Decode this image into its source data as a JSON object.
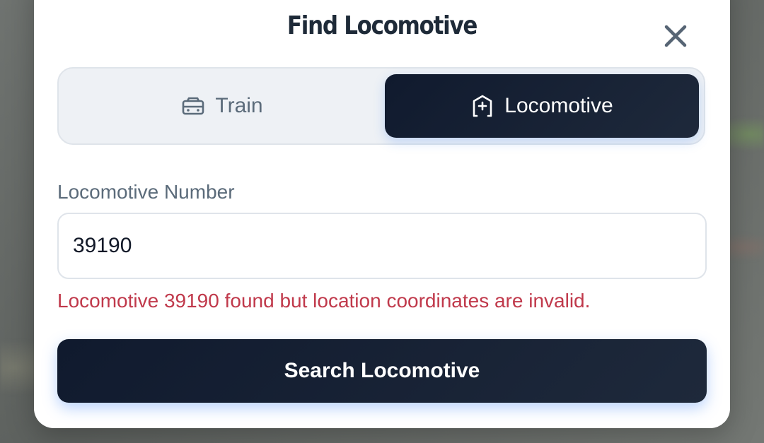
{
  "dialog": {
    "title": "Find Locomotive",
    "close_icon": "close-icon"
  },
  "mode_toggle": {
    "options": [
      {
        "label": "Train",
        "icon": "train-icon",
        "selected": false
      },
      {
        "label": "Locomotive",
        "icon": "locomotive-icon",
        "selected": true
      }
    ]
  },
  "form": {
    "label": "Locomotive Number",
    "value": "39190",
    "error": "Locomotive 39190 found but location coordinates are invalid."
  },
  "actions": {
    "search_label": "Search Locomotive"
  },
  "colors": {
    "primary_dark": "#101a2e",
    "error": "#c0394b",
    "muted_text": "#5b6b7a",
    "accent_glow": "#3b82f6"
  }
}
